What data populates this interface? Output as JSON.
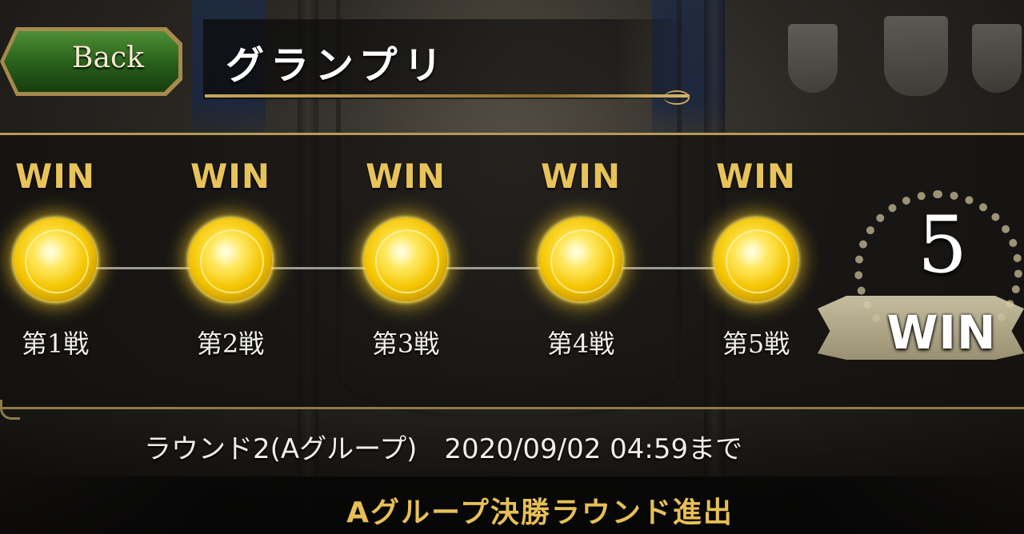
{
  "header": {
    "back_label": "Back",
    "title": "グランプリ"
  },
  "battles": [
    {
      "result": "WIN",
      "label": "第1戦"
    },
    {
      "result": "WIN",
      "label": "第2戦"
    },
    {
      "result": "WIN",
      "label": "第3戦"
    },
    {
      "result": "WIN",
      "label": "第4戦"
    },
    {
      "result": "WIN",
      "label": "第5戦"
    }
  ],
  "total": {
    "count": "5",
    "label": "WIN"
  },
  "footer": {
    "round_info": "ラウンド2(Aグループ)　2020/09/02 04:59まで",
    "advance_text": "Aグループ決勝ラウンド進出"
  },
  "colors": {
    "gold": "#e8c35a",
    "back_button_green": "#2f6b20",
    "panel_border": "#b59a55"
  },
  "icons": {
    "coin": "gold-win-coin-icon",
    "laurel": "laurel-wreath-icon",
    "back": "chevron-left-icon"
  }
}
